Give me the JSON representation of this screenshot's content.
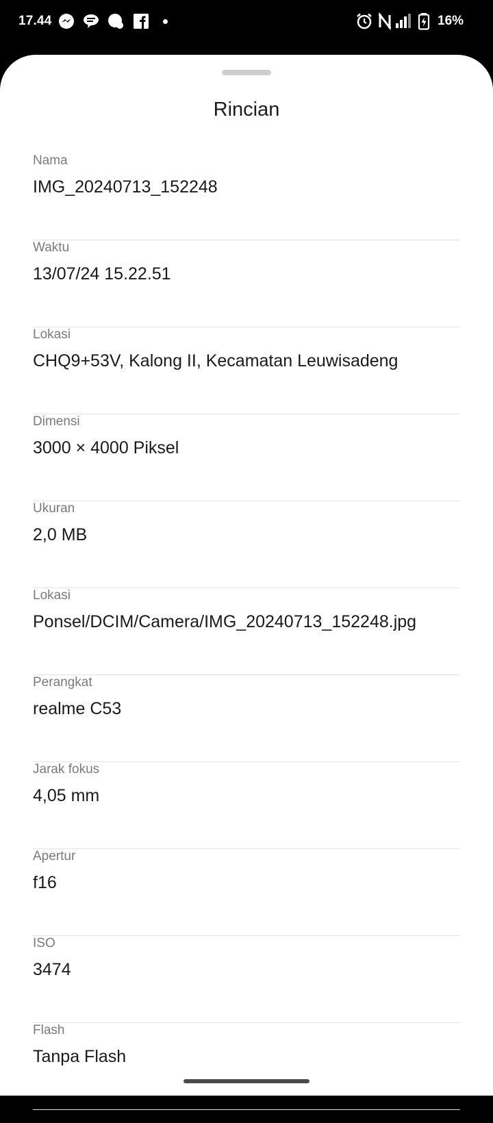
{
  "status_bar": {
    "time": "17.44",
    "notification_icons": [
      "messenger-icon",
      "chat-bubble-icon",
      "chat-icon",
      "facebook-icon"
    ],
    "system_icons": [
      "alarm-icon",
      "nfc-icon",
      "signal-icon",
      "battery-charging-icon"
    ],
    "battery_percent": "16%"
  },
  "sheet": {
    "title": "Rincian",
    "items": [
      {
        "label": "Nama",
        "value": "IMG_20240713_152248"
      },
      {
        "label": "Waktu",
        "value": "13/07/24 15.22.51"
      },
      {
        "label": "Lokasi",
        "value": "CHQ9+53V, Kalong II, Kecamatan Leuwisadeng"
      },
      {
        "label": "Dimensi",
        "value": "3000 × 4000 Piksel"
      },
      {
        "label": "Ukuran",
        "value": "2,0 MB"
      },
      {
        "label": "Lokasi",
        "value": "Ponsel/DCIM/Camera/IMG_20240713_152248.jpg"
      },
      {
        "label": "Perangkat",
        "value": "realme C53"
      },
      {
        "label": "Jarak fokus",
        "value": "4,05 mm"
      },
      {
        "label": "Apertur",
        "value": "f16"
      },
      {
        "label": "ISO",
        "value": "3474"
      },
      {
        "label": "Flash",
        "value": "Tanpa Flash"
      }
    ]
  }
}
